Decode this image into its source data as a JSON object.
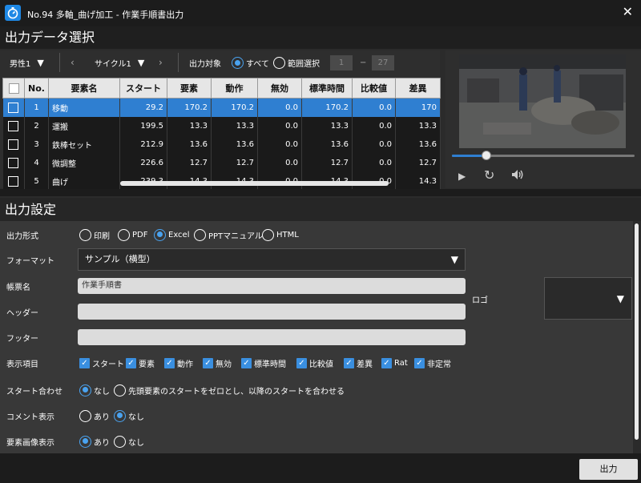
{
  "window": {
    "title": "No.94 多軸_曲げ加工 - 作業手順書出力"
  },
  "sections": {
    "select_title": "出力データ選択",
    "settings_title": "出力設定"
  },
  "toolbar": {
    "worker": "男性1",
    "cycle": "サイクル1",
    "target_label": "出力対象",
    "all_label": "すべて",
    "range_label": "範囲選択",
    "range_from": "1",
    "range_to": "27",
    "range_dash": "−"
  },
  "table": {
    "headers": [
      "No.",
      "要素名",
      "スタート",
      "要素",
      "動作",
      "無効",
      "標準時間",
      "比較値",
      "差異"
    ],
    "rows": [
      {
        "no": "1",
        "name": "移動",
        "start": "29.2",
        "element": "170.2",
        "motion": "170.2",
        "invalid": "0.0",
        "std": "170.2",
        "cmp": "0.0",
        "diff": "170"
      },
      {
        "no": "2",
        "name": "運搬",
        "start": "199.5",
        "element": "13.3",
        "motion": "13.3",
        "invalid": "0.0",
        "std": "13.3",
        "cmp": "0.0",
        "diff": "13.3"
      },
      {
        "no": "3",
        "name": "鉄棒セット",
        "start": "212.9",
        "element": "13.6",
        "motion": "13.6",
        "invalid": "0.0",
        "std": "13.6",
        "cmp": "0.0",
        "diff": "13.6"
      },
      {
        "no": "4",
        "name": "微調整",
        "start": "226.6",
        "element": "12.7",
        "motion": "12.7",
        "invalid": "0.0",
        "std": "12.7",
        "cmp": "0.0",
        "diff": "12.7"
      },
      {
        "no": "5",
        "name": "曲げ",
        "start": "239.3",
        "element": "14.3",
        "motion": "14.3",
        "invalid": "0.0",
        "std": "14.3",
        "cmp": "0.0",
        "diff": "14.3"
      }
    ],
    "selected_row": 1
  },
  "video": {
    "progress": 0.19
  },
  "settings": {
    "format_type": {
      "label": "出力形式",
      "options": [
        "印刷",
        "PDF",
        "Excel",
        "PPTマニュアル",
        "HTML"
      ],
      "selected": "Excel"
    },
    "format": {
      "label": "フォーマット",
      "value": "サンプル（横型）"
    },
    "title": {
      "label": "帳票名",
      "value": "作業手順書"
    },
    "header": {
      "label": "ヘッダー",
      "value": ""
    },
    "footer": {
      "label": "フッター",
      "value": ""
    },
    "logo": {
      "label": "ロゴ"
    },
    "display_items": {
      "label": "表示項目",
      "items": [
        "スタート",
        "要素",
        "動作",
        "無効",
        "標準時間",
        "比較値",
        "差異",
        "Rat",
        "非定常"
      ]
    },
    "start_align": {
      "label": "スタート合わせ",
      "options": [
        "なし",
        "先頭要素のスタートをゼロとし、以降のスタートを合わせる"
      ],
      "selected": "なし"
    },
    "comment": {
      "label": "コメント表示",
      "options": [
        "あり",
        "なし"
      ],
      "selected": "なし"
    },
    "element_image": {
      "label": "要素画像表示",
      "options": [
        "あり",
        "なし"
      ],
      "selected": "あり"
    }
  },
  "footer": {
    "output_button": "出力"
  },
  "colors": {
    "accent": "#2f7fd1",
    "background": "#2b2b2b"
  }
}
